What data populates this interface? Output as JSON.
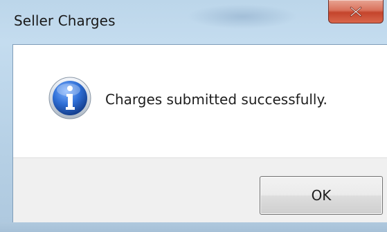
{
  "window": {
    "title": "Seller Charges",
    "close_icon": "close-x-icon"
  },
  "dialog": {
    "icon": "information-icon",
    "message": "Charges submitted successfully.",
    "ok_label": "OK"
  },
  "colors": {
    "frame": "#bcd6ea",
    "close_button": "#c4442c",
    "info_icon": "#1f5fbf",
    "button_area": "#f0f0f0"
  }
}
